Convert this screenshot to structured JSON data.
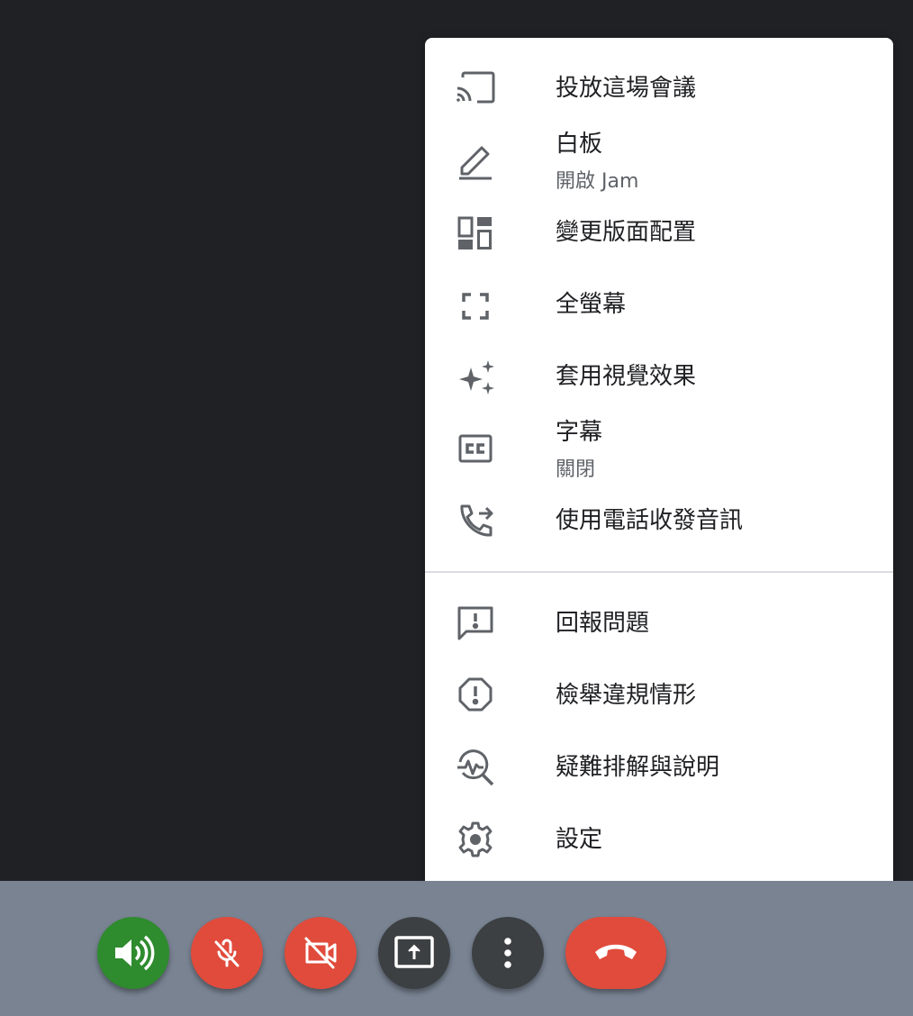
{
  "menu": {
    "items": [
      {
        "label": "投放這場會議",
        "icon": "cast-icon"
      },
      {
        "label": "白板",
        "sublabel": "開啟 Jam",
        "icon": "pen-icon"
      },
      {
        "label": "變更版面配置",
        "icon": "layout-icon"
      },
      {
        "label": "全螢幕",
        "icon": "fullscreen-icon"
      },
      {
        "label": "套用視覺效果",
        "icon": "sparkle-icon"
      },
      {
        "label": "字幕",
        "sublabel": "關閉",
        "icon": "closed-caption-icon"
      },
      {
        "label": "使用電話收發音訊",
        "icon": "phone-forward-icon"
      },
      {
        "label": "回報問題",
        "icon": "feedback-icon"
      },
      {
        "label": "檢舉違規情形",
        "icon": "report-icon"
      },
      {
        "label": "疑難排解與說明",
        "icon": "troubleshoot-icon"
      },
      {
        "label": "設定",
        "icon": "gear-icon"
      }
    ]
  },
  "toolbar": {
    "buttons": [
      {
        "name": "speaker",
        "icon": "speaker-icon",
        "color": "#2e8b2e"
      },
      {
        "name": "microphone",
        "icon": "mic-off-icon",
        "color": "#e04b3c"
      },
      {
        "name": "camera",
        "icon": "camera-off-icon",
        "color": "#e04b3c"
      },
      {
        "name": "present",
        "icon": "present-screen-icon",
        "color": "#3c4043"
      },
      {
        "name": "more-options",
        "icon": "more-vert-icon",
        "color": "#3c4043"
      },
      {
        "name": "end-call",
        "icon": "end-call-icon",
        "color": "#e04b3c"
      }
    ]
  }
}
